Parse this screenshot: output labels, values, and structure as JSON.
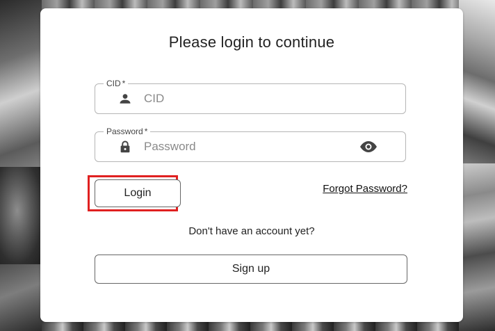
{
  "title": "Please login to continue",
  "cid_field": {
    "label": "CID",
    "required_mark": "*",
    "placeholder": "CID",
    "value": "",
    "icon": "person-icon"
  },
  "password_field": {
    "label": "Password",
    "required_mark": "*",
    "placeholder": "Password",
    "value": "",
    "icon": "lock-icon",
    "toggle_icon": "eye-icon"
  },
  "login_button": {
    "label": "Login"
  },
  "forgot_link": {
    "label": "Forgot Password?"
  },
  "signup_prompt": "Don't have an account yet?",
  "signup_button": {
    "label": "Sign up"
  },
  "colors": {
    "highlight": "#e02020",
    "border": "#b5b5b5",
    "text": "#222222"
  }
}
